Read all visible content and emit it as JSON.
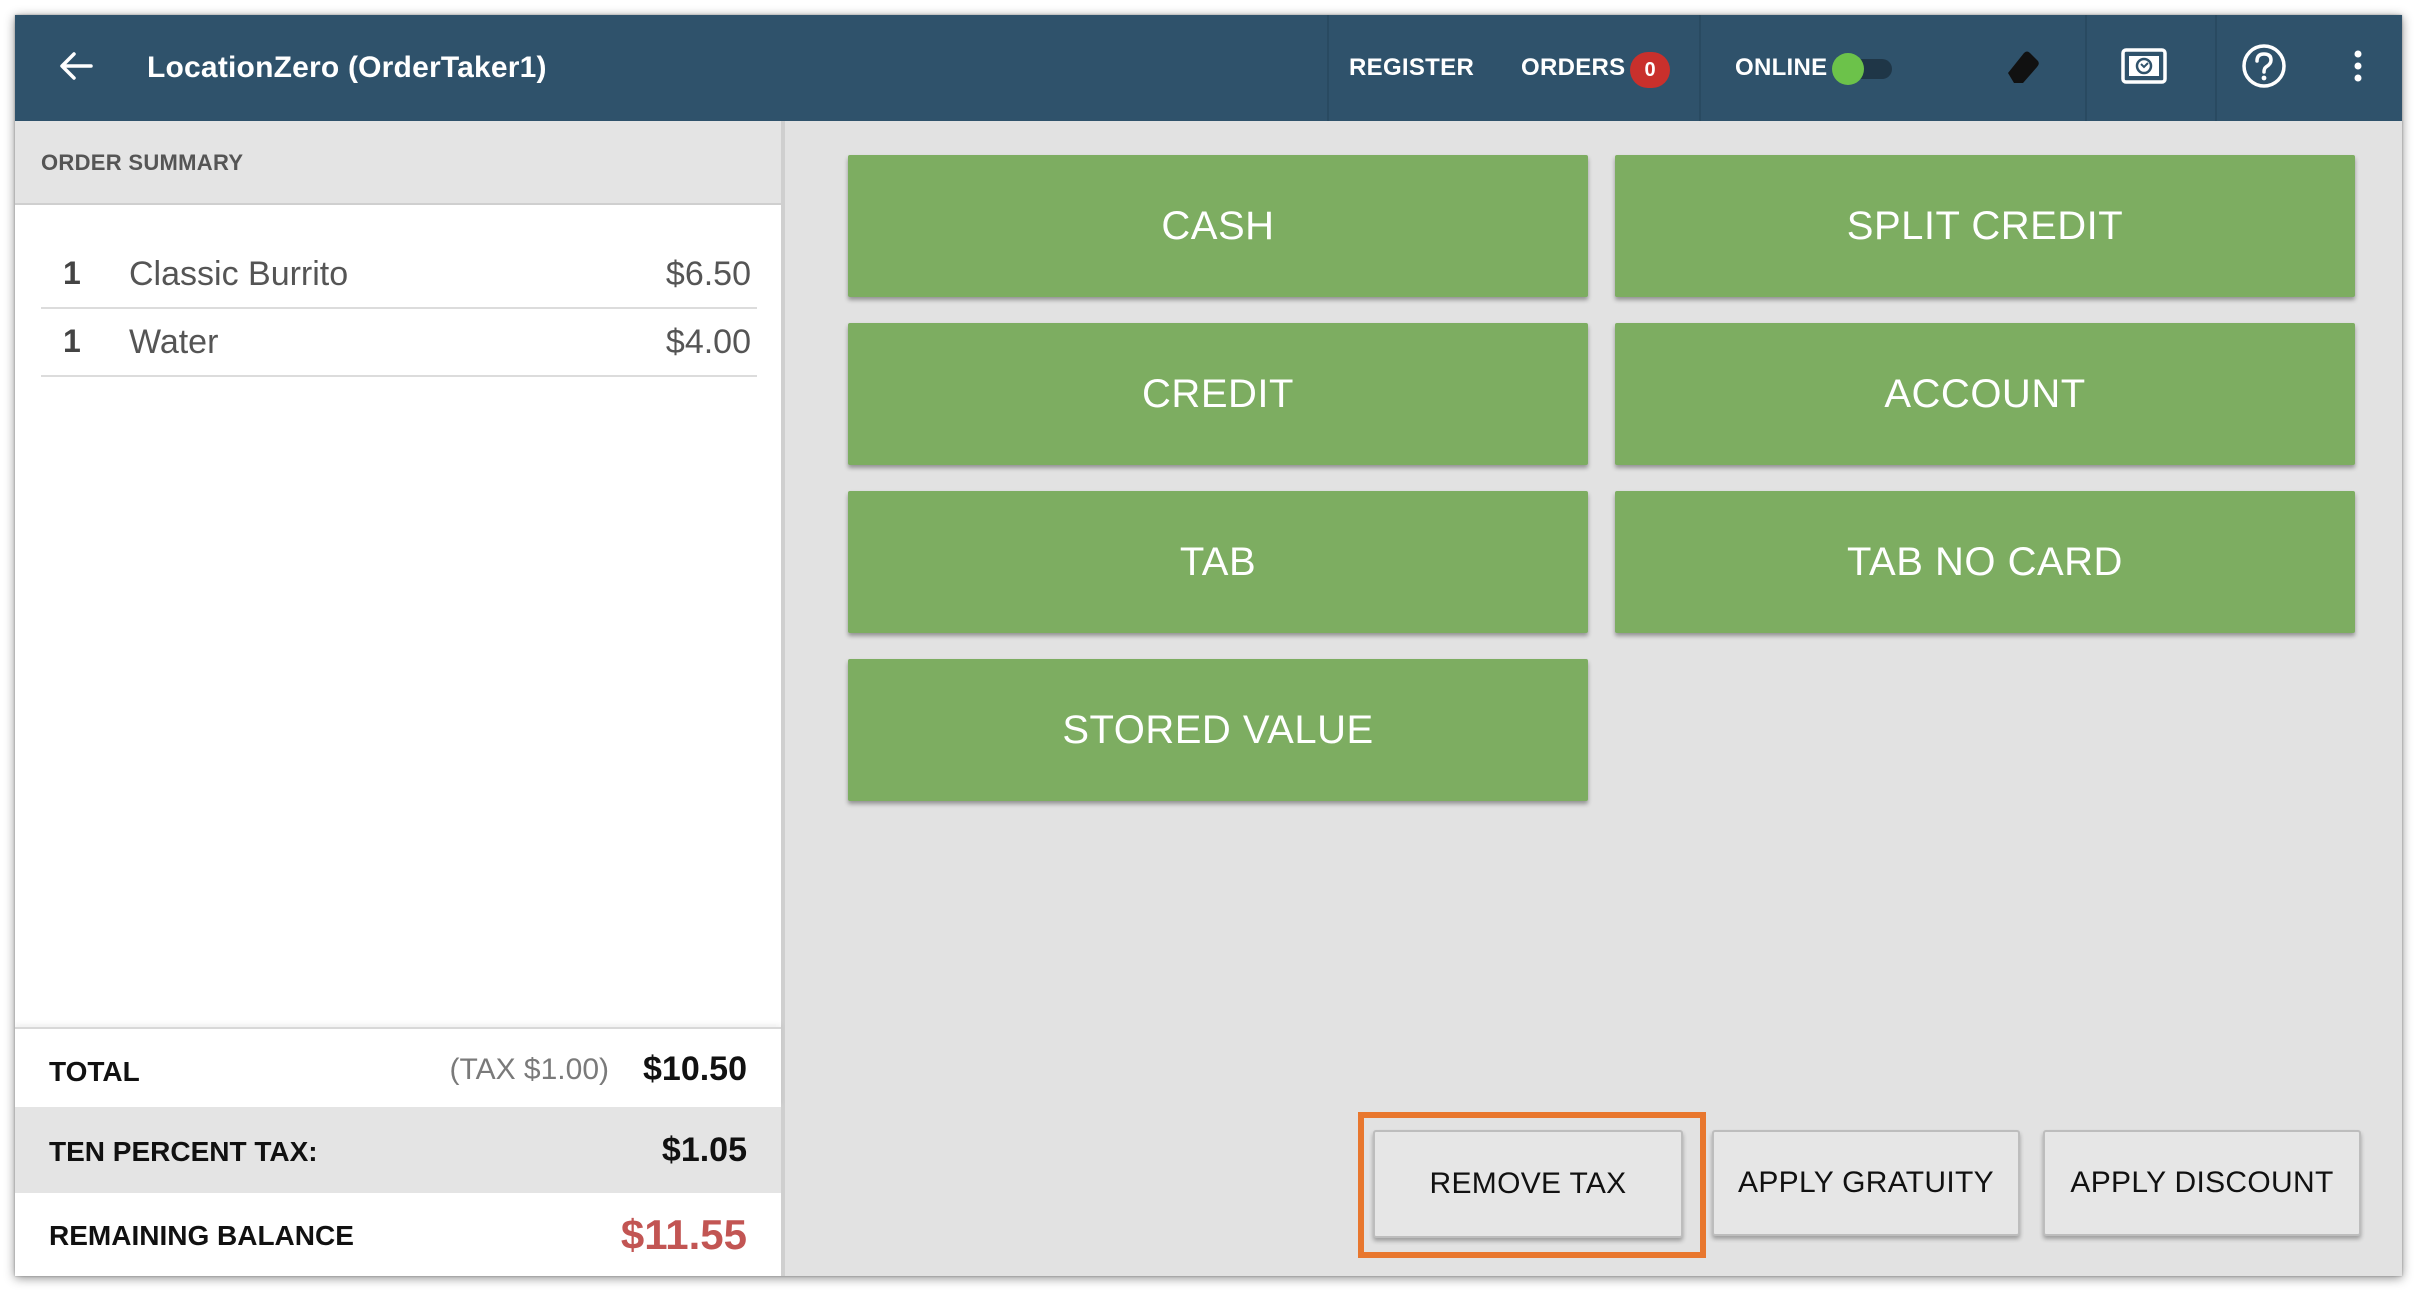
{
  "colors": {
    "topbar": "#2f526b",
    "payment_button": "#7dad61",
    "online_indicator": "#6cc24a",
    "badge": "#c9302c",
    "balance_text": "#c25553",
    "highlight": "#e8772e"
  },
  "header": {
    "back_icon": "arrow-left-icon",
    "title": "LocationZero (OrderTaker1)",
    "register_label": "REGISTER",
    "orders_label": "ORDERS",
    "orders_count": "0",
    "online_label": "ONLINE",
    "online_enabled": true,
    "icons": [
      "eraser-icon",
      "cash-drawer-icon",
      "help-icon",
      "more-vert-icon"
    ]
  },
  "order_summary": {
    "header": "ORDER SUMMARY",
    "items": [
      {
        "qty": "1",
        "name": "Classic Burrito",
        "price": "$6.50"
      },
      {
        "qty": "1",
        "name": "Water",
        "price": "$4.00"
      }
    ]
  },
  "totals": {
    "total_label": "TOTAL",
    "total_tax_note": "(TAX $1.00)",
    "total_value": "$10.50",
    "tax_label": "TEN PERCENT TAX:",
    "tax_value": "$1.05",
    "balance_label": "REMAINING BALANCE",
    "balance_value": "$11.55"
  },
  "payment_methods": [
    "CASH",
    "SPLIT CREDIT",
    "CREDIT",
    "ACCOUNT",
    "TAB",
    "TAB NO CARD",
    "STORED VALUE"
  ],
  "actions": {
    "remove_tax": "REMOVE TAX",
    "apply_gratuity": "APPLY GRATUITY",
    "apply_discount": "APPLY DISCOUNT"
  }
}
